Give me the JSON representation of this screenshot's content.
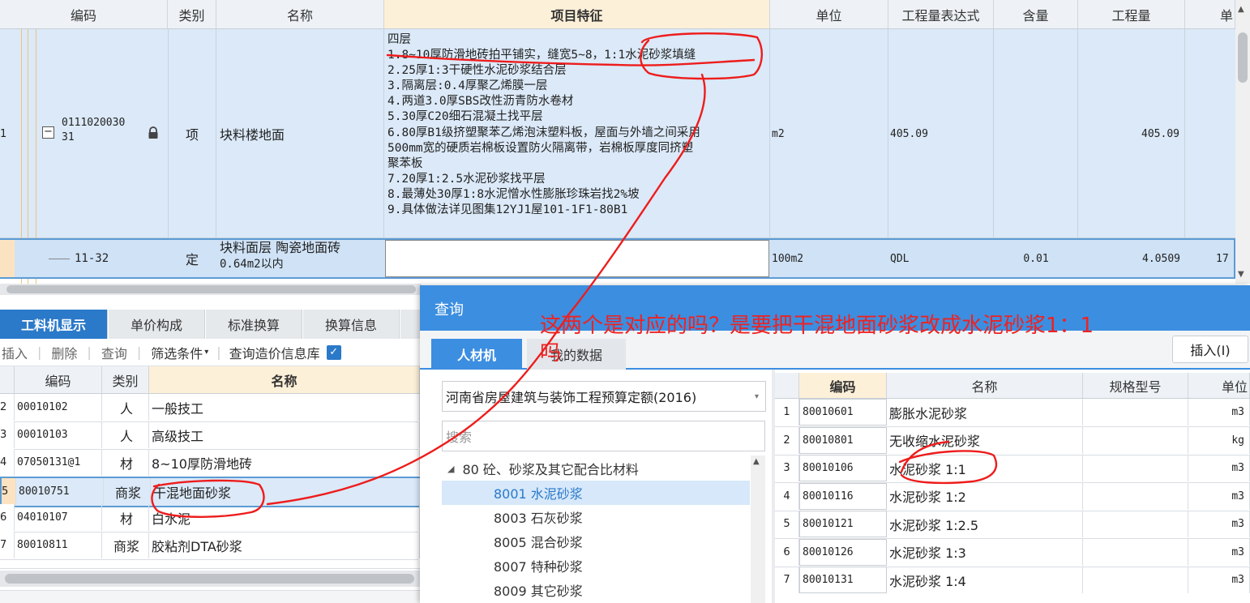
{
  "main_grid": {
    "headers": [
      "编码",
      "类别",
      "名称",
      "项目特征",
      "单位",
      "工程量表达式",
      "含量",
      "工程量",
      "单"
    ],
    "row1": {
      "index": "1",
      "code_line1": "0111020030",
      "code_line2": "31",
      "category": "项",
      "name": "块料楼地面",
      "features": [
        "四层",
        "1.8~10厚防滑地砖拍平铺实，缝宽5~8，1:1水泥砂浆填缝",
        "2.25厚1:3干硬性水泥砂浆结合层",
        "3.隔离层:0.4厚聚乙烯膜一层",
        "4.两道3.0厚SBS改性沥青防水卷材",
        "5.30厚C20细石混凝土找平层",
        "6.80厚B1级挤塑聚苯乙烯泡沫塑料板，屋面与外墙之间采用",
        "500mm宽的硬质岩棉板设置防火隔离带，岩棉板厚度同挤塑",
        "聚苯板",
        "7.20厚1:2.5水泥砂浆找平层",
        "8.最薄处30厚1:8水泥憎水性膨胀珍珠岩找2%坡",
        "9.具体做法详见图集12YJ1屋101-1F1-80B1"
      ],
      "unit": "m2",
      "expression": "405.09",
      "quantity": "405.09"
    },
    "row2": {
      "code": "11-32",
      "category": "定",
      "name_line1": "块料面层 陶瓷地面砖",
      "name_line2": "0.64m2以内",
      "unit": "100m2",
      "expression": "QDL",
      "content": "0.01",
      "quantity": "4.0509",
      "price_partial": "17"
    }
  },
  "bottom_tabs": [
    "工料机显示",
    "单价构成",
    "标准换算",
    "换算信息"
  ],
  "bottom_toolbar": {
    "insert": "插入",
    "delete": "删除",
    "query": "查询",
    "filter": "筛选条件",
    "query_price": "查询造价信息库"
  },
  "material_table": {
    "headers": [
      "编码",
      "类别",
      "名称"
    ],
    "rows": [
      {
        "idx": "2",
        "code": "00010102",
        "cat": "人",
        "name": "一般技工"
      },
      {
        "idx": "3",
        "code": "00010103",
        "cat": "人",
        "name": "高级技工"
      },
      {
        "idx": "4",
        "code": "07050131@1",
        "cat": "材",
        "name": "8~10厚防滑地砖"
      },
      {
        "idx": "5",
        "code": "80010751",
        "cat": "商浆",
        "name": "干混地面砂浆"
      },
      {
        "idx": "6",
        "code": "04010107",
        "cat": "材",
        "name": "白水泥"
      },
      {
        "idx": "7",
        "code": "80010811",
        "cat": "商浆",
        "name": "胶粘剂DTA砂浆"
      }
    ]
  },
  "dialog": {
    "title": "查询",
    "tabs": [
      "人材机",
      "我的数据"
    ],
    "insert_button": "插入(I)",
    "quota_select": "河南省房屋建筑与装饰工程预算定额(2016)",
    "search_placeholder": "搜索",
    "tree": {
      "root": "80 砼、砂浆及其它配合比材料",
      "children": [
        "8001 水泥砂浆",
        "8003 石灰砂浆",
        "8005 混合砂浆",
        "8007 特种砂浆",
        "8009 其它砂浆"
      ]
    },
    "result_headers": [
      "编码",
      "名称",
      "规格型号",
      "单位"
    ],
    "results": [
      {
        "idx": "1",
        "code": "80010601",
        "name": "膨胀水泥砂浆",
        "unit": "m3"
      },
      {
        "idx": "2",
        "code": "80010801",
        "name": "无收缩水泥砂浆",
        "unit": "kg"
      },
      {
        "idx": "3",
        "code": "80010106",
        "name": "水泥砂浆 1:1",
        "unit": "m3"
      },
      {
        "idx": "4",
        "code": "80010116",
        "name": "水泥砂浆 1:2",
        "unit": "m3"
      },
      {
        "idx": "5",
        "code": "80010121",
        "name": "水泥砂浆 1:2.5",
        "unit": "m3"
      },
      {
        "idx": "6",
        "code": "80010126",
        "name": "水泥砂浆 1:3",
        "unit": "m3"
      },
      {
        "idx": "7",
        "code": "80010131",
        "name": "水泥砂浆 1:4",
        "unit": "m3"
      }
    ]
  },
  "annotation": {
    "line1": "这两个是对应的吗？是要把干混地面砂浆改成水泥砂浆1：1",
    "line2": "吗"
  },
  "colors": {
    "accent": "#3c8ee0",
    "selected": "#dbe9f8",
    "annotation": "#ee2222",
    "header_highlight": "#fdf0d8"
  }
}
